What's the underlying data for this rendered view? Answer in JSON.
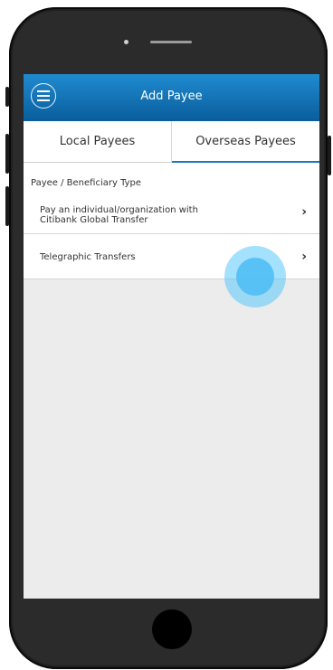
{
  "header": {
    "title": "Add Payee",
    "menu_icon": "hamburger-menu-icon",
    "color_top": "#1f8bd0",
    "color_bottom": "#0a5d9c"
  },
  "tabs": [
    {
      "label": "Local Payees",
      "active": false
    },
    {
      "label": "Overseas Payees",
      "active": true
    }
  ],
  "section": {
    "label": "Payee / Beneficiary Type"
  },
  "options": [
    {
      "line1": "Pay an individual/organization with",
      "line2": "Citibank Global Transfer",
      "icon": "chevron-right-icon"
    },
    {
      "label": "Telegraphic Transfers",
      "icon": "chevron-right-icon"
    }
  ],
  "glyphs": {
    "chevron": "›"
  },
  "accent": "#1a78c2"
}
